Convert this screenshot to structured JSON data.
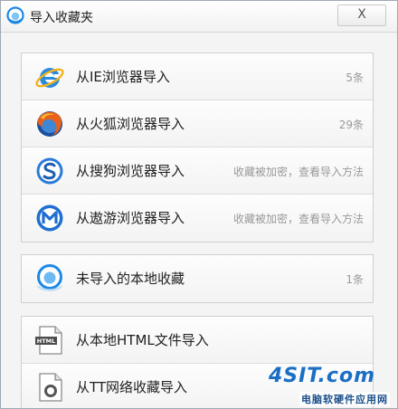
{
  "window": {
    "title": "导入收藏夹",
    "close_label": "X"
  },
  "groups": [
    {
      "rows": [
        {
          "label": "从IE浏览器导入",
          "meta": "5条",
          "icon": "ie-icon"
        },
        {
          "label": "从火狐浏览器导入",
          "meta": "29条",
          "icon": "firefox-icon"
        },
        {
          "label": "从搜狗浏览器导入",
          "meta": "收藏被加密，查看导入方法",
          "icon": "sogou-icon"
        },
        {
          "label": "从遨游浏览器导入",
          "meta": "收藏被加密，查看导入方法",
          "icon": "maxthon-icon"
        }
      ]
    },
    {
      "rows": [
        {
          "label": "未导入的本地收藏",
          "meta": "1条",
          "icon": "cloud-local-icon"
        }
      ]
    },
    {
      "rows": [
        {
          "label": "从本地HTML文件导入",
          "meta": "",
          "icon": "html-file-icon"
        },
        {
          "label": "从TT网络收藏导入",
          "meta": "",
          "icon": "tt-icon"
        }
      ]
    }
  ],
  "watermark": {
    "logo": "4SIT.com",
    "subtitle": "电脑软硬件应用网"
  }
}
